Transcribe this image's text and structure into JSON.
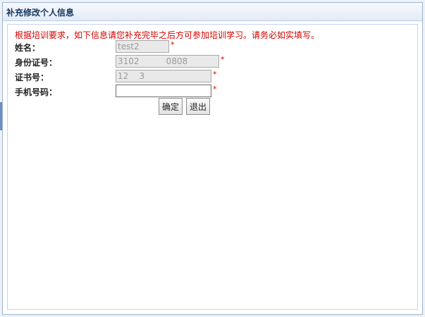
{
  "window": {
    "title": "补充修改个人信息"
  },
  "form": {
    "notice": "根据培训要求，如下信息请您补充完毕之后方可参加培训学习。请务必如实填写。",
    "fields": [
      {
        "label": "姓名：",
        "value": "test2",
        "required_mark": "*"
      },
      {
        "label": "身份证号：",
        "value": "3102          0808",
        "required_mark": "*"
      },
      {
        "label": "证书号：",
        "value": "12    3",
        "required_mark": "*"
      },
      {
        "label": "手机号码：",
        "value": "",
        "required_mark": "*"
      }
    ]
  },
  "buttons": {
    "confirm_label": "确定",
    "exit_label": "退出"
  }
}
